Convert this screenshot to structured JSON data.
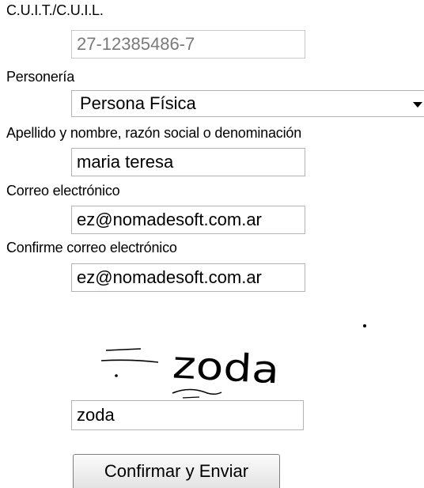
{
  "cuit": {
    "label": "C.U.I.T./C.U.I.L.",
    "value": "27-12385486-7"
  },
  "personeria": {
    "label": "Personería",
    "selected": "Persona Física"
  },
  "nombre": {
    "label": "Apellido y nombre, razón social o denominación",
    "value": "maria teresa"
  },
  "correo": {
    "label": "Correo electrónico",
    "value": "ez@nomadesoft.com.ar"
  },
  "confirmar_correo": {
    "label": "Confirme correo electrónico",
    "value": "ez@nomadesoft.com.ar"
  },
  "captcha": {
    "image_text": "zoda",
    "value": "zoda"
  },
  "submit": {
    "label": "Confirmar y Enviar"
  }
}
